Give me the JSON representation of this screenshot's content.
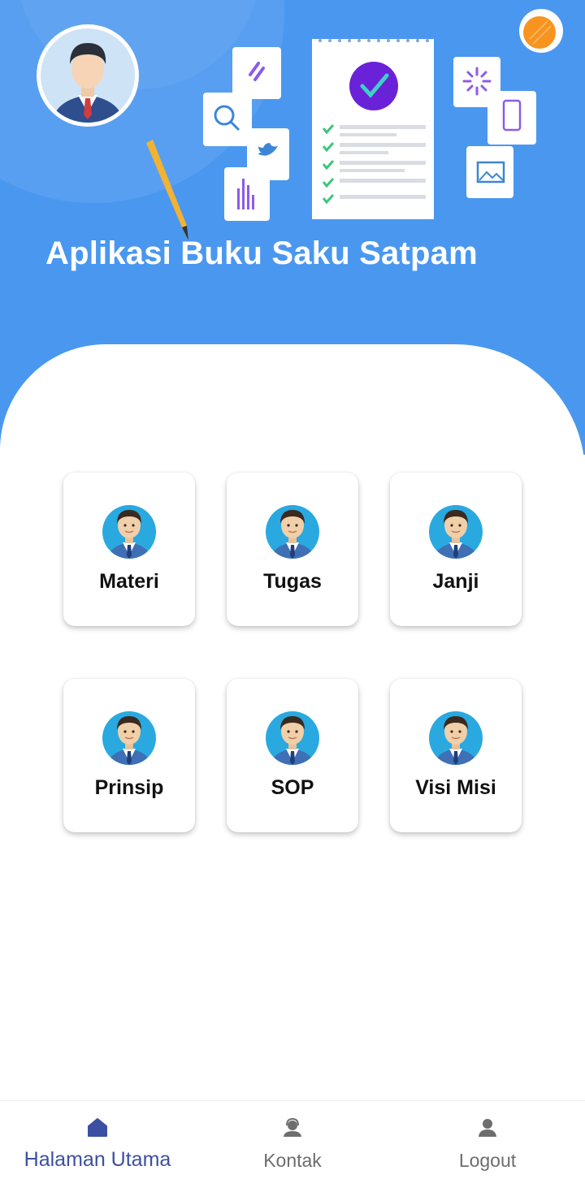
{
  "app": {
    "title": "Aplikasi Buku Saku Satpam"
  },
  "menu": [
    {
      "label": "Materi",
      "icon": "security-guard-icon"
    },
    {
      "label": "Tugas",
      "icon": "security-guard-icon"
    },
    {
      "label": "Janji",
      "icon": "security-guard-icon"
    },
    {
      "label": "Prinsip",
      "icon": "security-guard-icon"
    },
    {
      "label": "SOP",
      "icon": "security-guard-icon"
    },
    {
      "label": "Visi Misi",
      "icon": "security-guard-icon"
    }
  ],
  "bottom_nav": {
    "items": [
      {
        "label": "Halaman Utama",
        "icon": "home-icon",
        "active": true
      },
      {
        "label": "Kontak",
        "icon": "contact-support-icon",
        "active": false
      },
      {
        "label": "Logout",
        "icon": "user-icon",
        "active": false
      }
    ]
  },
  "colors": {
    "header_blue": "#4a97f0",
    "active_nav": "#3c4fa3",
    "inactive_nav": "#6d6d6d",
    "avatar_circle": "#29a9e0"
  }
}
